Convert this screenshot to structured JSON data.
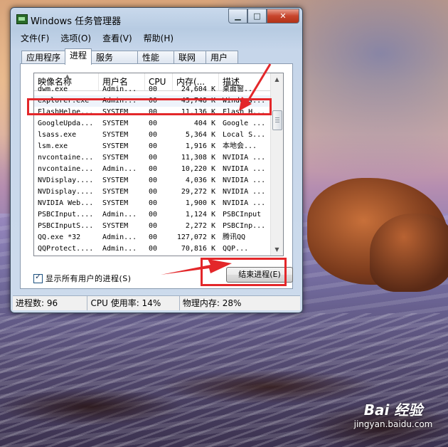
{
  "window": {
    "title": "Windows 任务管理器",
    "controls": {
      "minimize": "▁",
      "maximize": "□",
      "close": "✕"
    }
  },
  "menu": [
    "文件(F)",
    "选项(O)",
    "查看(V)",
    "帮助(H)"
  ],
  "tabs": [
    {
      "label": "应用程序",
      "active": false
    },
    {
      "label": "进程",
      "active": true
    },
    {
      "label": "服务",
      "active": false
    },
    {
      "label": "性能",
      "active": false
    },
    {
      "label": "联网",
      "active": false
    },
    {
      "label": "用户",
      "active": false
    }
  ],
  "columns": [
    "映像名称",
    "用户名",
    "CPU",
    "内存(...",
    "描述"
  ],
  "rows": [
    {
      "name": "dwm.exe",
      "user": "Admin...",
      "cpu": "00",
      "mem": "24,604 K",
      "desc": "桌面窗...",
      "partial": true
    },
    {
      "name": "explorer.exe",
      "user": "Admin...",
      "cpu": "00",
      "mem": "43,748 K",
      "desc": "Windows...",
      "selected": true
    },
    {
      "name": "FlashHelpe...",
      "user": "SYSTEM",
      "cpu": "00",
      "mem": "11,136 K",
      "desc": "Flash H..."
    },
    {
      "name": "GoogleUpda...",
      "user": "SYSTEM",
      "cpu": "00",
      "mem": "404 K",
      "desc": "Google ..."
    },
    {
      "name": "lsass.exe",
      "user": "SYSTEM",
      "cpu": "00",
      "mem": "5,364 K",
      "desc": "Local S..."
    },
    {
      "name": "lsm.exe",
      "user": "SYSTEM",
      "cpu": "00",
      "mem": "1,916 K",
      "desc": "本地会..."
    },
    {
      "name": "nvcontaine...",
      "user": "SYSTEM",
      "cpu": "00",
      "mem": "11,308 K",
      "desc": "NVIDIA ..."
    },
    {
      "name": "nvcontaine...",
      "user": "Admin...",
      "cpu": "00",
      "mem": "10,220 K",
      "desc": "NVIDIA ..."
    },
    {
      "name": "NVDisplay....",
      "user": "SYSTEM",
      "cpu": "00",
      "mem": "4,036 K",
      "desc": "NVIDIA ..."
    },
    {
      "name": "NVDisplay....",
      "user": "SYSTEM",
      "cpu": "00",
      "mem": "29,272 K",
      "desc": "NVIDIA ..."
    },
    {
      "name": "NVIDIA Web...",
      "user": "SYSTEM",
      "cpu": "00",
      "mem": "1,900 K",
      "desc": "NVIDIA ..."
    },
    {
      "name": "PSBCInput....",
      "user": "Admin...",
      "cpu": "00",
      "mem": "1,124 K",
      "desc": "PSBCInput"
    },
    {
      "name": "PSBCInputS...",
      "user": "SYSTEM",
      "cpu": "00",
      "mem": "2,272 K",
      "desc": "PSBCInp..."
    },
    {
      "name": "QQ.exe *32",
      "user": "Admin...",
      "cpu": "00",
      "mem": "127,072 K",
      "desc": "腾讯QQ"
    },
    {
      "name": "QQProtect....",
      "user": "Admin...",
      "cpu": "00",
      "mem": "70,816 K",
      "desc": "QQP...",
      "partial": true
    }
  ],
  "show_all_users": {
    "label": "显示所有用户的进程(S)",
    "checked": true
  },
  "end_process_button": "结束进程(E)",
  "status": {
    "processes": "进程数: 96",
    "cpu": "CPU 使用率: 14%",
    "memory": "物理内存: 28%"
  },
  "watermark": {
    "logo": "Bai  经验",
    "url": "jingyan.baidu.com"
  },
  "colors": {
    "annotation": "#e3272a"
  }
}
